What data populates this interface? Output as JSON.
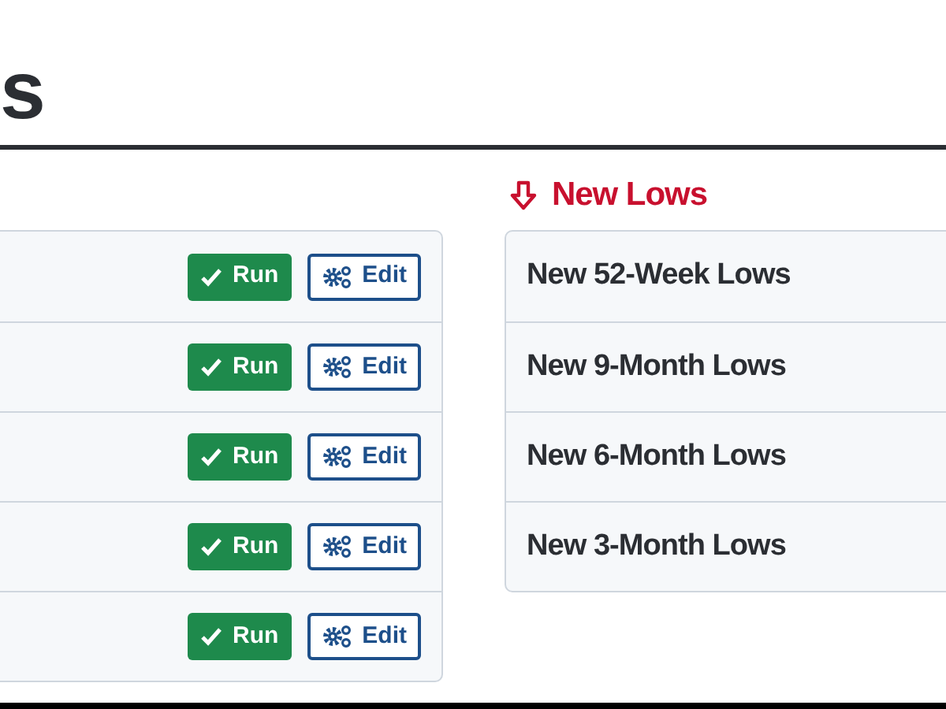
{
  "page_heading": "s",
  "screens": {
    "rows": [
      {
        "run_label": "Run",
        "edit_label": "Edit"
      },
      {
        "run_label": "Run",
        "edit_label": "Edit"
      },
      {
        "run_label": "Run",
        "edit_label": "Edit"
      },
      {
        "run_label": "Run",
        "edit_label": "Edit"
      },
      {
        "run_label": "Run",
        "edit_label": "Edit"
      }
    ]
  },
  "new_lows": {
    "title": "New Lows",
    "items": [
      "New 52-Week Lows",
      "New 9-Month Lows",
      "New 6-Month Lows",
      "New 3-Month Lows"
    ]
  }
}
